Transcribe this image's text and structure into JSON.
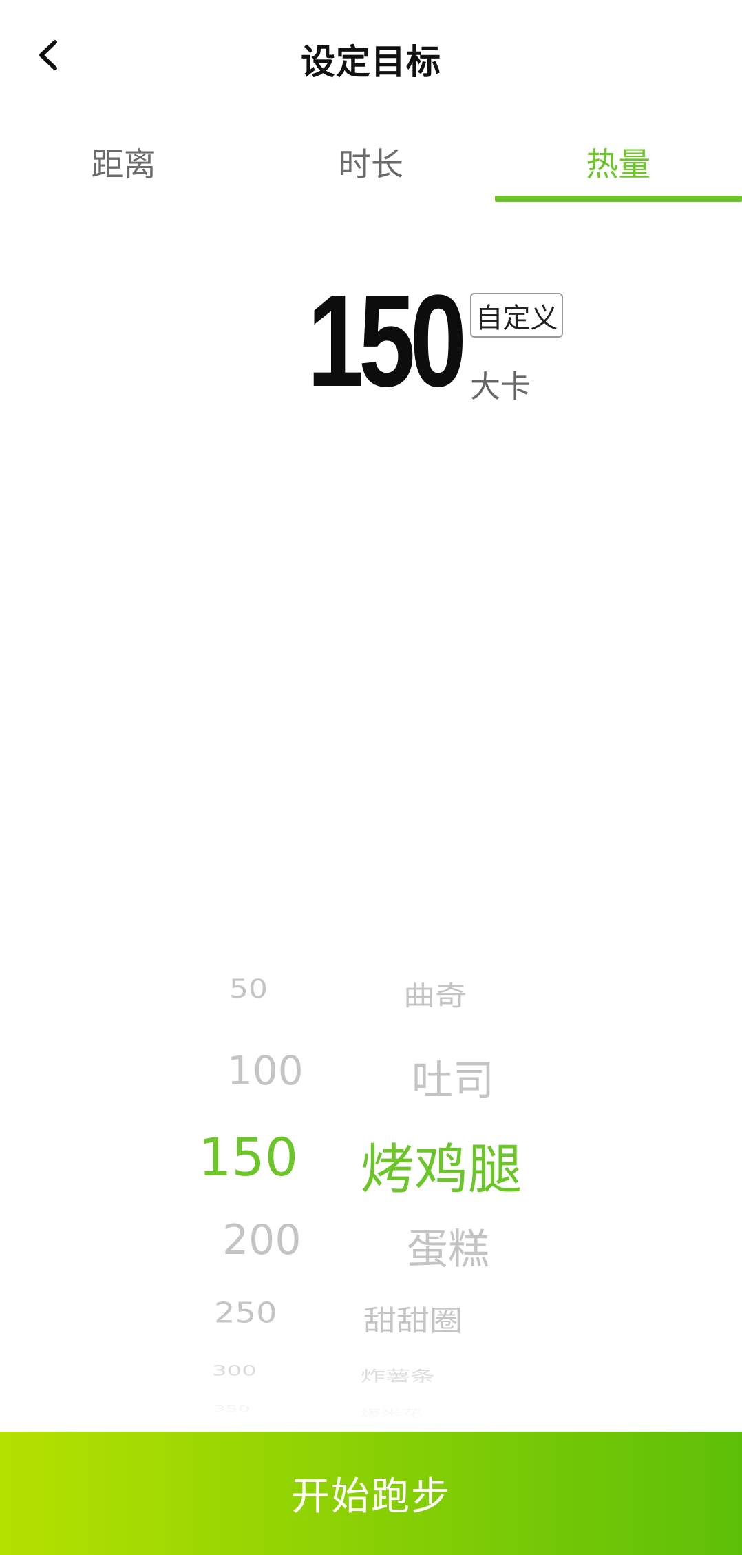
{
  "colors": {
    "accent": "#6cc62a",
    "gradient_start": "#b5e100",
    "gradient_end": "#5dbf08",
    "inactive_text": "#6b6b6b",
    "picker_inactive": "#c4c4c4"
  },
  "header": {
    "back_icon": "chevron-left-icon",
    "title": "设定目标"
  },
  "tabs": [
    {
      "label": "距离",
      "active": false
    },
    {
      "label": "时长",
      "active": false
    },
    {
      "label": "热量",
      "active": true
    }
  ],
  "goal": {
    "value": "150",
    "custom_label": "自定义",
    "unit": "大卡"
  },
  "picker": {
    "selected_index": 2,
    "items": [
      {
        "value": "50",
        "food": "曲奇"
      },
      {
        "value": "100",
        "food": "吐司"
      },
      {
        "value": "150",
        "food": "烤鸡腿"
      },
      {
        "value": "200",
        "food": "蛋糕"
      },
      {
        "value": "250",
        "food": "甜甜圈"
      },
      {
        "value": "300",
        "food": "炸薯条"
      },
      {
        "value": "350",
        "food": "爆米花"
      }
    ]
  },
  "start_button": {
    "label": "开始跑步"
  }
}
